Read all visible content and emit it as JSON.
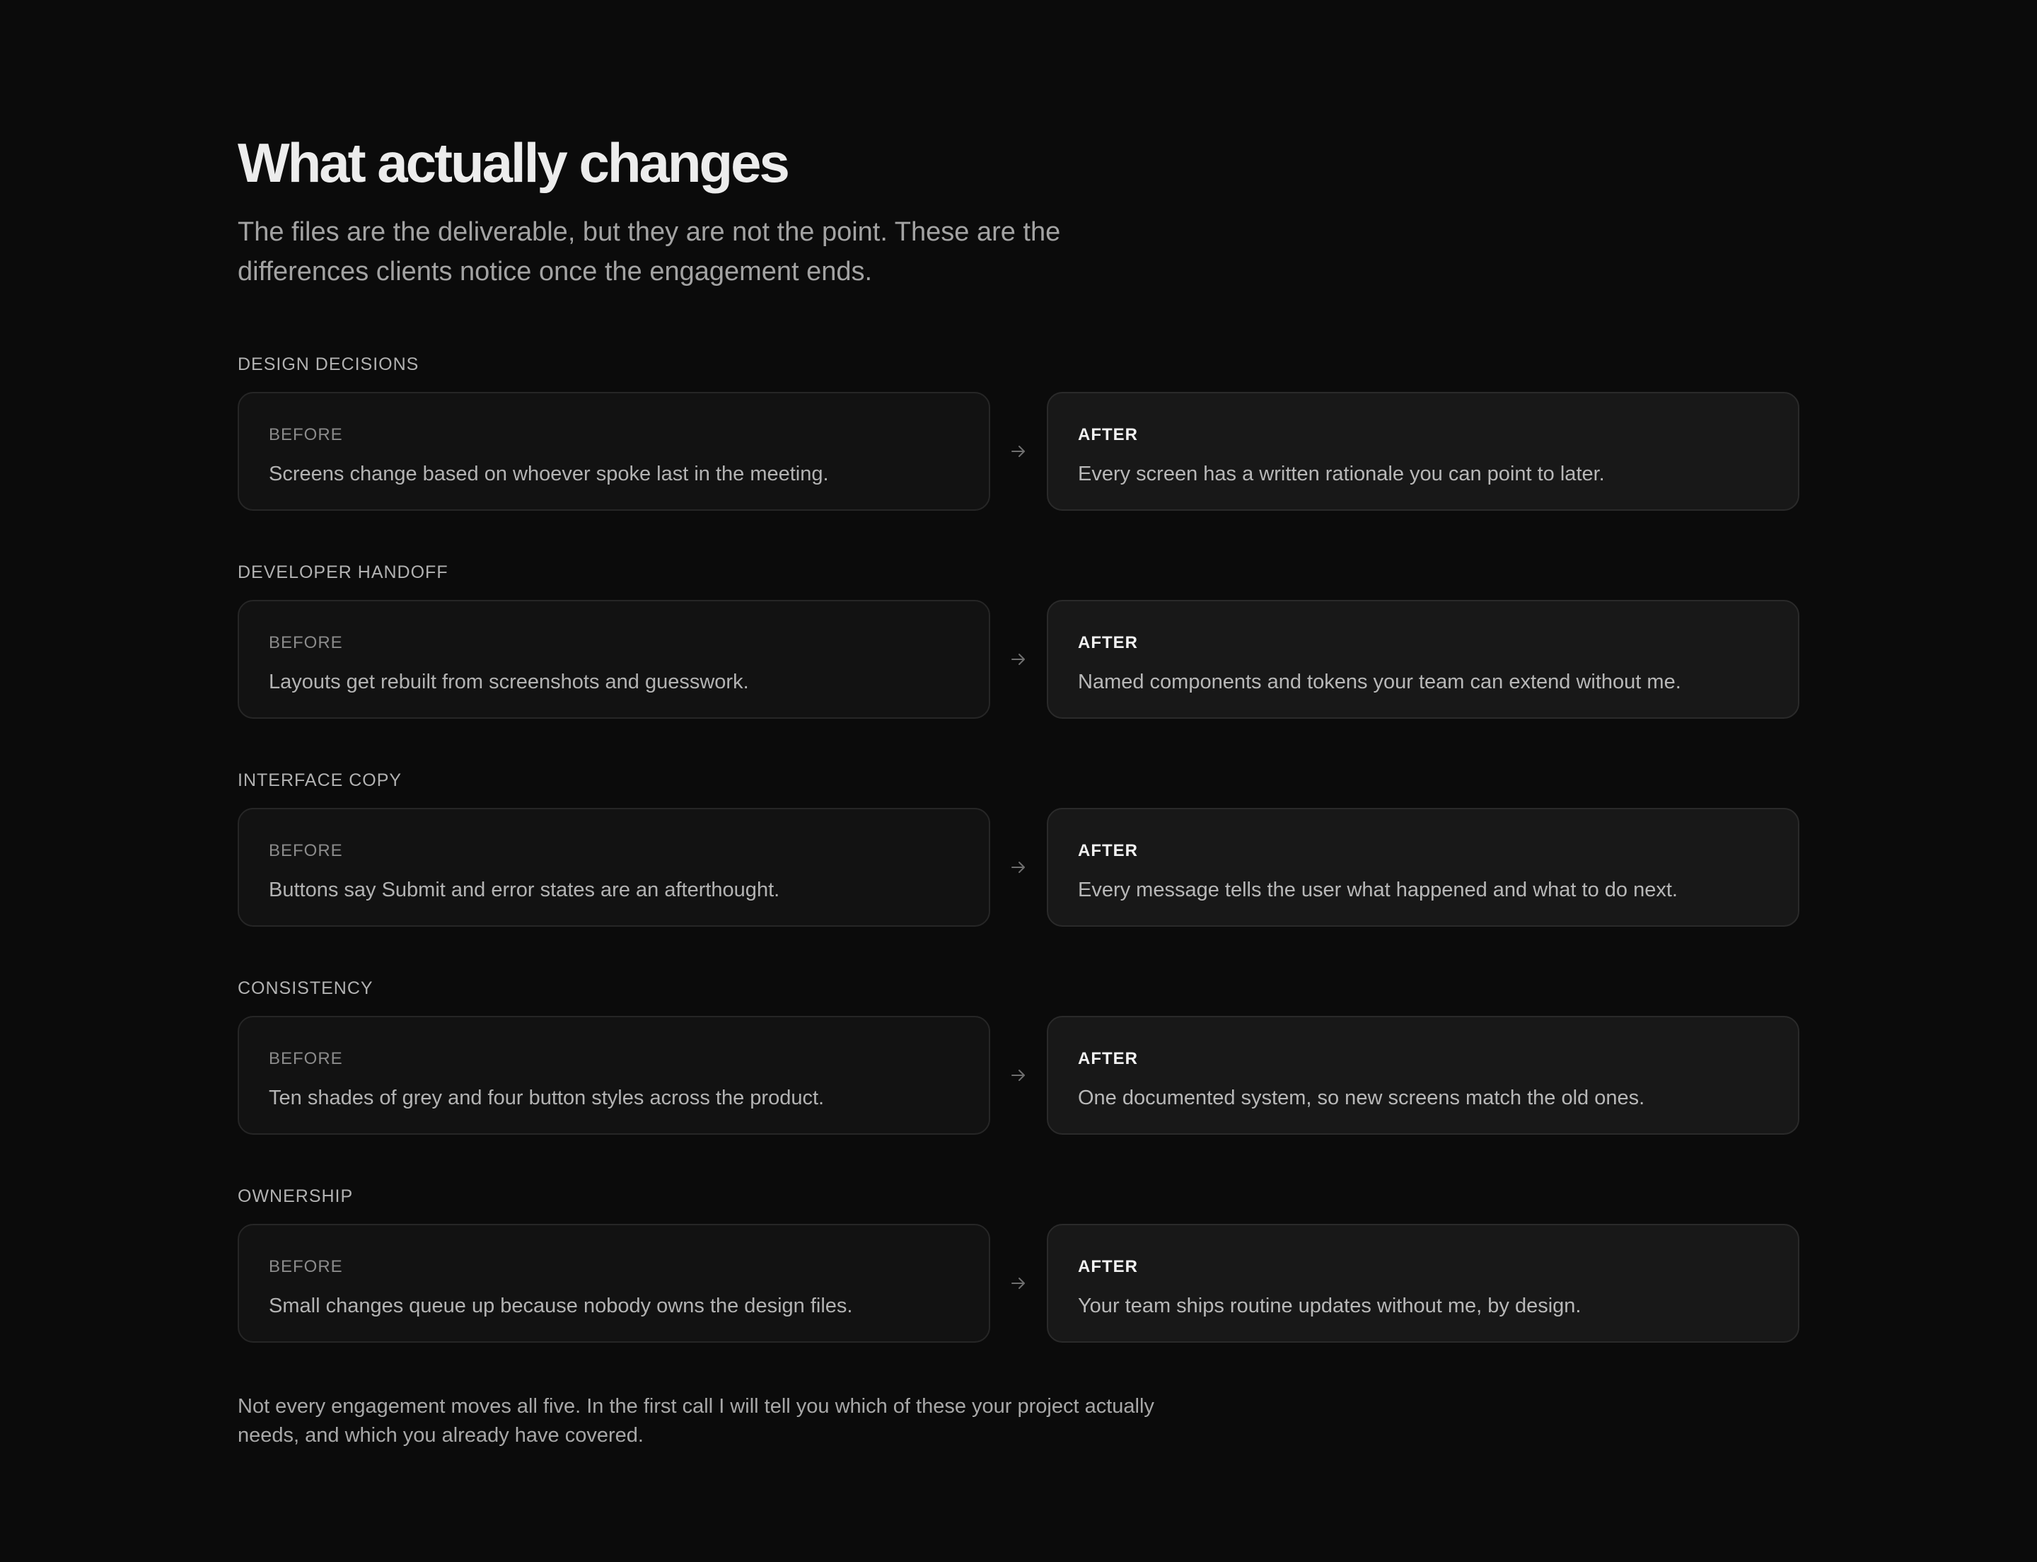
{
  "header": {
    "title": "What actually changes",
    "subtitle": "The files are the deliverable, but they are not the point. These are the differences clients notice once the engagement ends."
  },
  "labels": {
    "before": "BEFORE",
    "after": "AFTER"
  },
  "icons": {
    "arrow": "arrow-right-icon"
  },
  "sections": [
    {
      "label": "DESIGN DECISIONS",
      "before": "Screens change based on whoever spoke last in the meeting.",
      "after": "Every screen has a written rationale you can point to later."
    },
    {
      "label": "DEVELOPER HANDOFF",
      "before": "Layouts get rebuilt from screenshots and guesswork.",
      "after": "Named components and tokens your team can extend without me."
    },
    {
      "label": "INTERFACE COPY",
      "before": "Buttons say Submit and error states are an afterthought.",
      "after": "Every message tells the user what happened and what to do next."
    },
    {
      "label": "CONSISTENCY",
      "before": "Ten shades of grey and four button styles across the product.",
      "after": "One documented system, so new screens match the old ones."
    },
    {
      "label": "OWNERSHIP",
      "before": "Small changes queue up because nobody owns the design files.",
      "after": "Your team ships routine updates without me, by design."
    }
  ],
  "footnote": "Not every engagement moves all five. In the first call I will tell you which of these your project actually needs, and which you already have covered."
}
